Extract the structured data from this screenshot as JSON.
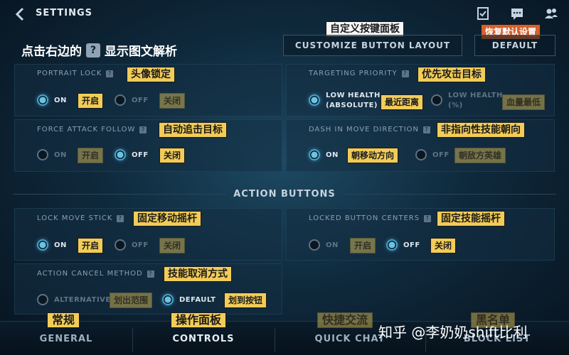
{
  "topbar": {
    "title": "SETTINGS",
    "icons": [
      "back-arrow-icon",
      "checklist-icon",
      "chat-icon",
      "friends-icon"
    ]
  },
  "header": {
    "hint_before": "点击右边的",
    "hint_q": "?",
    "hint_after": "显示图文解析",
    "customize_tag": "自定义按键面板",
    "customize_button": "CUSTOMIZE BUTTON LAYOUT",
    "default_tag": "恢复默认设置",
    "default_button": "DEFAULT"
  },
  "panels": {
    "portrait_lock": {
      "label": "PORTRAIT LOCK",
      "tag": "头像锁定",
      "opt1": "ON",
      "opt1_tag": "开启",
      "opt2": "OFF",
      "opt2_tag": "关闭",
      "selected": "ON"
    },
    "targeting_priority": {
      "label": "TARGETING PRIORITY",
      "tag": "优先攻击目标",
      "opt1": "LOW HEALTH",
      "opt1_sub": "(ABSOLUTE)",
      "opt1_tag": "最近距离",
      "opt2": "LOW HEALTH",
      "opt2_sub": "(%)",
      "opt2_tag": "血量最低",
      "selected": "LOW HEALTH (ABSOLUTE)"
    },
    "force_attack_follow": {
      "label": "FORCE ATTACK FOLLOW",
      "tag": "自动追击目标",
      "opt1": "ON",
      "opt1_tag": "开启",
      "opt2": "OFF",
      "opt2_tag": "关闭",
      "selected": "OFF"
    },
    "dash_in_move_direction": {
      "label": "DASH IN MOVE DIRECTION",
      "tag": "非指向性技能朝向",
      "opt1": "ON",
      "opt1_tag": "朝移动方向",
      "opt2": "OFF",
      "opt2_tag": "朝敌方英雄",
      "selected": "ON"
    },
    "section_title": "ACTION BUTTONS",
    "lock_move_stick": {
      "label": "LOCK MOVE STICK",
      "tag": "固定移动摇杆",
      "opt1": "ON",
      "opt1_tag": "开启",
      "opt2": "OFF",
      "opt2_tag": "关闭",
      "selected": "ON"
    },
    "locked_button_centers": {
      "label": "LOCKED BUTTON CENTERS",
      "tag": "固定技能摇杆",
      "opt1": "ON",
      "opt1_tag": "开启",
      "opt2": "OFF",
      "opt2_tag": "关闭",
      "selected": "OFF"
    },
    "action_cancel_method": {
      "label": "ACTION CANCEL METHOD",
      "tag": "技能取消方式",
      "opt1": "ALTERNATIVE",
      "opt1_tag": "划出范围",
      "opt2": "DEFAULT",
      "opt2_tag": "划到按钮",
      "selected": "DEFAULT"
    }
  },
  "tabs": [
    {
      "label": "GENERAL",
      "tag": "常规"
    },
    {
      "label": "CONTROLS",
      "tag": "操作面板",
      "active": true
    },
    {
      "label": "QUICK CHAT",
      "tag": "快捷交流"
    },
    {
      "label": "BLOCK LIST",
      "tag": "黑名单"
    }
  ],
  "watermark": "知乎 @李奶奶shift比利",
  "colors": {
    "tag_yellow": "#f2cc58",
    "tag_red": "#d7602c",
    "radio_on": "#4aa3c8",
    "background": "#0f2a3d"
  }
}
